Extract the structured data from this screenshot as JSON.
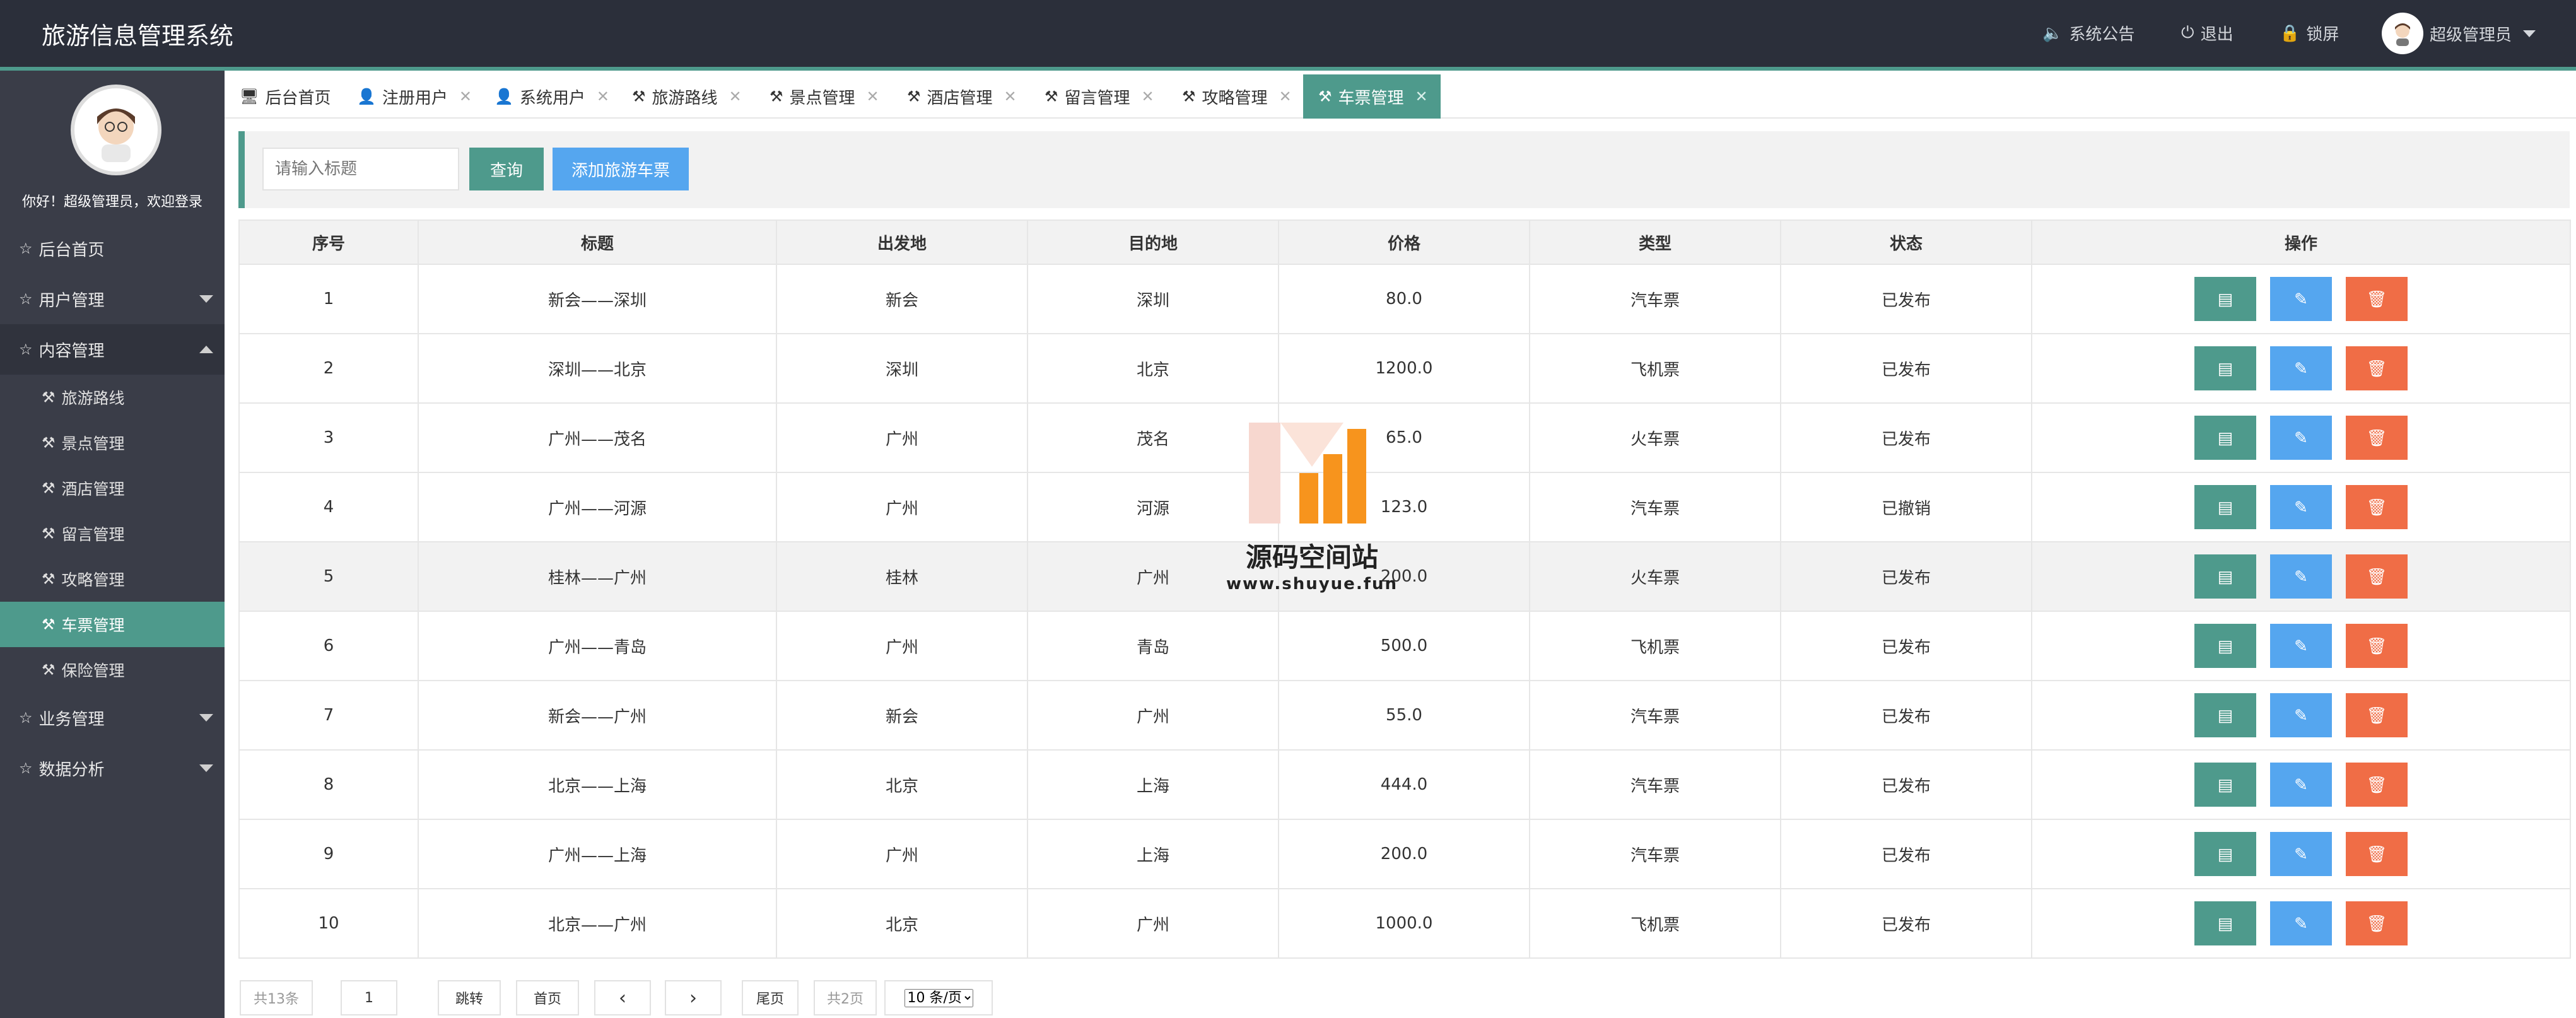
{
  "app": {
    "title": "旅游信息管理系统"
  },
  "header": {
    "notice": "系统公告",
    "logout": "退出",
    "lock": "锁屏",
    "user": "超级管理员"
  },
  "sidebar": {
    "welcome": "你好！超级管理员，欢迎登录",
    "groups": [
      {
        "label": "后台首页"
      },
      {
        "label": "用户管理"
      },
      {
        "label": "内容管理"
      },
      {
        "label": "业务管理"
      },
      {
        "label": "数据分析"
      }
    ],
    "sub_items": [
      {
        "label": "旅游路线"
      },
      {
        "label": "景点管理"
      },
      {
        "label": "酒店管理"
      },
      {
        "label": "留言管理"
      },
      {
        "label": "攻略管理"
      },
      {
        "label": "车票管理"
      },
      {
        "label": "保险管理"
      }
    ]
  },
  "tabs": [
    {
      "label": "后台首页"
    },
    {
      "label": "注册用户"
    },
    {
      "label": "系统用户"
    },
    {
      "label": "旅游路线"
    },
    {
      "label": "景点管理"
    },
    {
      "label": "酒店管理"
    },
    {
      "label": "留言管理"
    },
    {
      "label": "攻略管理"
    },
    {
      "label": "车票管理"
    }
  ],
  "toolbar": {
    "search_placeholder": "请输入标题",
    "query_label": "查询",
    "add_label": "添加旅游车票"
  },
  "table": {
    "headers": [
      "序号",
      "标题",
      "出发地",
      "目的地",
      "价格",
      "类型",
      "状态",
      "操作"
    ],
    "rows": [
      {
        "no": "1",
        "title": "新会——深圳",
        "from": "新会",
        "to": "深圳",
        "price": "80.0",
        "type": "汽车票",
        "status": "已发布"
      },
      {
        "no": "2",
        "title": "深圳——北京",
        "from": "深圳",
        "to": "北京",
        "price": "1200.0",
        "type": "飞机票",
        "status": "已发布"
      },
      {
        "no": "3",
        "title": "广州——茂名",
        "from": "广州",
        "to": "茂名",
        "price": "65.0",
        "type": "火车票",
        "status": "已发布"
      },
      {
        "no": "4",
        "title": "广州——河源",
        "from": "广州",
        "to": "河源",
        "price": "123.0",
        "type": "汽车票",
        "status": "已撤销"
      },
      {
        "no": "5",
        "title": "桂林——广州",
        "from": "桂林",
        "to": "广州",
        "price": "200.0",
        "type": "火车票",
        "status": "已发布"
      },
      {
        "no": "6",
        "title": "广州——青岛",
        "from": "广州",
        "to": "青岛",
        "price": "500.0",
        "type": "飞机票",
        "status": "已发布"
      },
      {
        "no": "7",
        "title": "新会——广州",
        "from": "新会",
        "to": "广州",
        "price": "55.0",
        "type": "汽车票",
        "status": "已发布"
      },
      {
        "no": "8",
        "title": "北京——上海",
        "from": "北京",
        "to": "上海",
        "price": "444.0",
        "type": "汽车票",
        "status": "已发布"
      },
      {
        "no": "9",
        "title": "广州——上海",
        "from": "广州",
        "to": "上海",
        "price": "200.0",
        "type": "汽车票",
        "status": "已发布"
      },
      {
        "no": "10",
        "title": "北京——广州",
        "from": "北京",
        "to": "广州",
        "price": "1000.0",
        "type": "飞机票",
        "status": "已发布"
      }
    ]
  },
  "pagination": {
    "total": "共13条",
    "page_input": "1",
    "jump": "跳转",
    "first": "首页",
    "last": "尾页",
    "pages": "共2页",
    "page_size": "10 条/页"
  },
  "watermark": {
    "title": "源码空间站",
    "url": "www.shuyue.fun"
  },
  "colors": {
    "header_bg": "#2b2f3a",
    "sidebar_bg": "#3a3d48",
    "accent": "#4e9a8c",
    "primary": "#55a6ef",
    "danger": "#f06d46"
  }
}
